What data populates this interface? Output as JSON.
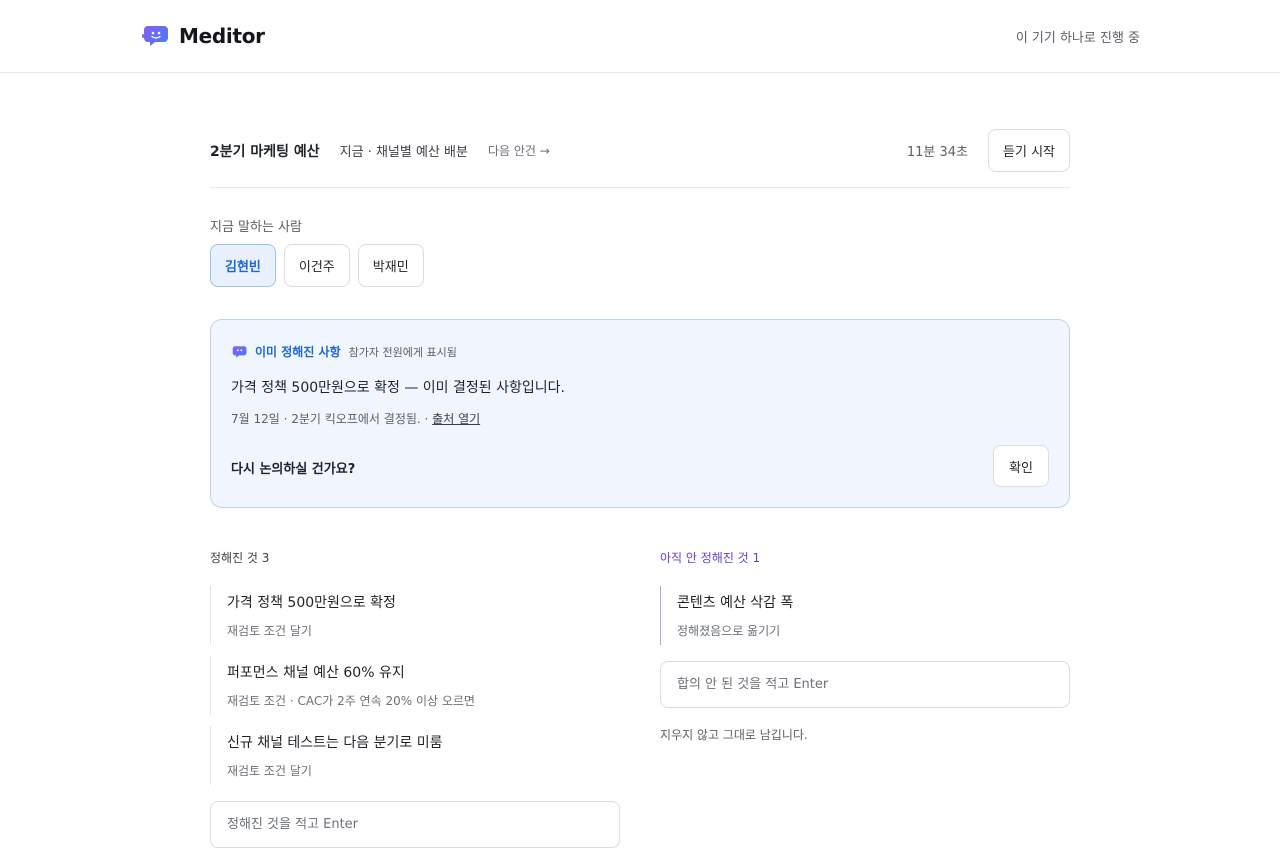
{
  "app": {
    "name": "Meditor",
    "device_status": "이 기기 하나로 진행 중",
    "brand_color": "#3b82f6",
    "accent_purple": "#6a3fd0"
  },
  "meeting": {
    "title": "2분기 마케팅 예산",
    "agenda_now": "지금 · 채널별 예산 배분",
    "agenda_next": "다음 안건 →",
    "timer": "11분 34초",
    "listen_label": "듣기 시작"
  },
  "speakers": {
    "label": "지금 말하는 사람",
    "items": [
      {
        "name": "김현빈",
        "active": true
      },
      {
        "name": "이건주",
        "active": false
      },
      {
        "name": "박재민",
        "active": false
      }
    ]
  },
  "notice": {
    "tag": "이미 정해진 사항",
    "visibility": "참가자 전원에게 표시됨",
    "text": "가격 정책 500만원으로 확정 — 이미 결정된 사항입니다.",
    "meta": "7월 12일 · 2분기 킥오프에서 결정됨. · ",
    "source_link": "출처 열기",
    "question": "다시 논의하실 건가요?",
    "confirm_label": "확인"
  },
  "decided": {
    "header": "정해진 것 3",
    "items": [
      {
        "title": "가격 정책 500만원으로 확정",
        "sub": "재검토 조건 달기"
      },
      {
        "title": "퍼포먼스 채널 예산 60% 유지",
        "sub": "재검토 조건 · CAC가 2주 연속 20% 이상 오르면"
      },
      {
        "title": "신규 채널 테스트는 다음 분기로 미룸",
        "sub": "재검토 조건 달기"
      }
    ],
    "input_placeholder": "정해진 것을 적고 Enter"
  },
  "undecided": {
    "header": "아직 안 정해진 것 1",
    "items": [
      {
        "title": "콘텐츠 예산 삭감 폭",
        "sub": "정해졌음으로 옮기기"
      }
    ],
    "input_placeholder": "합의 안 된 것을 적고 Enter",
    "note": "지우지 않고 그대로 남깁니다."
  }
}
